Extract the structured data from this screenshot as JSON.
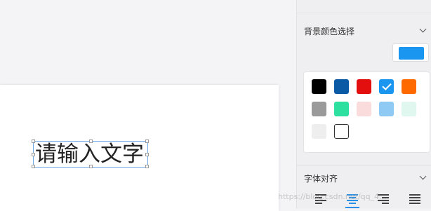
{
  "canvas": {
    "text_content": "请输入文字"
  },
  "panel": {
    "background_section": {
      "title": "背景颜色选择",
      "selected_color": "#1a96f0"
    },
    "palette": {
      "swatches": [
        {
          "name": "black",
          "color": "#000000",
          "selected": false
        },
        {
          "name": "dark-blue",
          "color": "#0a5aa6",
          "selected": false
        },
        {
          "name": "red",
          "color": "#e30e0e",
          "selected": false
        },
        {
          "name": "blue",
          "color": "#1a96f0",
          "selected": true
        },
        {
          "name": "orange",
          "color": "#ff6a00",
          "selected": false
        },
        {
          "name": "gray",
          "color": "#9a9a9a",
          "selected": false
        },
        {
          "name": "green",
          "color": "#2ee0a0",
          "selected": false
        },
        {
          "name": "light-pink",
          "color": "#fbdcdc",
          "selected": false
        },
        {
          "name": "light-blue",
          "color": "#8fcaf4",
          "selected": false
        },
        {
          "name": "mint",
          "color": "#dff7ee",
          "selected": false
        },
        {
          "name": "light-gray",
          "color": "#eeeeee",
          "selected": false
        },
        {
          "name": "white",
          "color": "#ffffff",
          "selected": false
        }
      ]
    },
    "align_section": {
      "title": "字体对齐",
      "active": "center"
    }
  },
  "watermark": "https://blog.csdn.net/qq_4...",
  "colors": {
    "accent": "#2a8fe6",
    "selection_border": "#6fa9e6"
  }
}
